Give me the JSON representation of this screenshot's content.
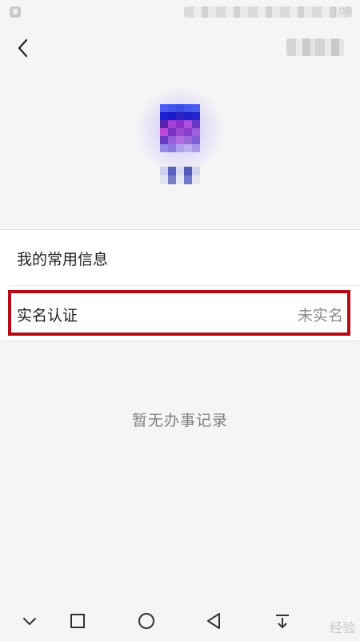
{
  "status_bar": {
    "time": "100"
  },
  "list": {
    "items": [
      {
        "label": "我的常用信息",
        "value": ""
      },
      {
        "label": "实名认证",
        "value": "未实名"
      }
    ]
  },
  "empty_state": {
    "text": "暂无办事记录"
  },
  "watermark": {
    "text": "经验"
  },
  "colors": {
    "background": "#f5f5f5",
    "highlight_border": "#b40a14",
    "row_background": "#ffffff"
  },
  "icons": {
    "back": "chevron-left-icon",
    "nav": [
      "chevron-down-icon",
      "square-icon",
      "circle-icon",
      "triangle-back-icon",
      "download-icon"
    ]
  }
}
